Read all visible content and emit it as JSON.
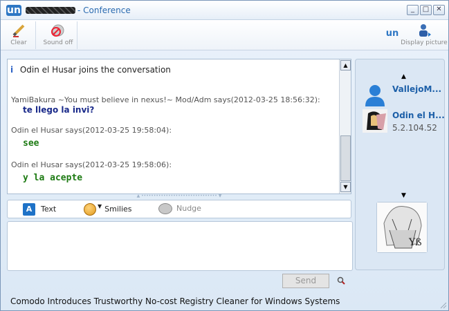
{
  "window": {
    "logo": "un",
    "title": "- Conference",
    "minimize": "_",
    "maximize": "□",
    "close": "✕"
  },
  "toolbar": {
    "clear_label": "Clear",
    "sound_label": "Sound off",
    "display_picture_label": "Display picture",
    "logo": "un"
  },
  "chat": {
    "system_message": "Odin el Husar joins the conversation",
    "messages": [
      {
        "header": "YamiBakura ~You must believe in nexus!~ Mod/Adm says(2012-03-25 18:56:32):",
        "body": "te llego la invi?",
        "color": "#1a2a8a"
      },
      {
        "header": "Odin el Husar says(2012-03-25 19:58:04):",
        "body": "see",
        "color": "#1c7a12"
      },
      {
        "header": "Odin el Husar says(2012-03-25 19:58:06):",
        "body": "y la acepte",
        "color": "#1c7a12"
      }
    ]
  },
  "format_bar": {
    "text_label": "Text",
    "text_icon": "A",
    "smilies_label": "Smilies",
    "nudge_label": "Nudge"
  },
  "input": {
    "value": ""
  },
  "send": {
    "label": "Send"
  },
  "participants": [
    {
      "name": "VallejoM...",
      "sub": ""
    },
    {
      "name": "Odin el H...",
      "sub": "5.2.104.52"
    }
  ],
  "status_bar": {
    "text": "Comodo Introduces Trustworthy No-cost Registry Cleaner for Windows Systems"
  },
  "colors": {
    "accent": "#2e77c4",
    "name_blue": "#1c5fa8"
  }
}
